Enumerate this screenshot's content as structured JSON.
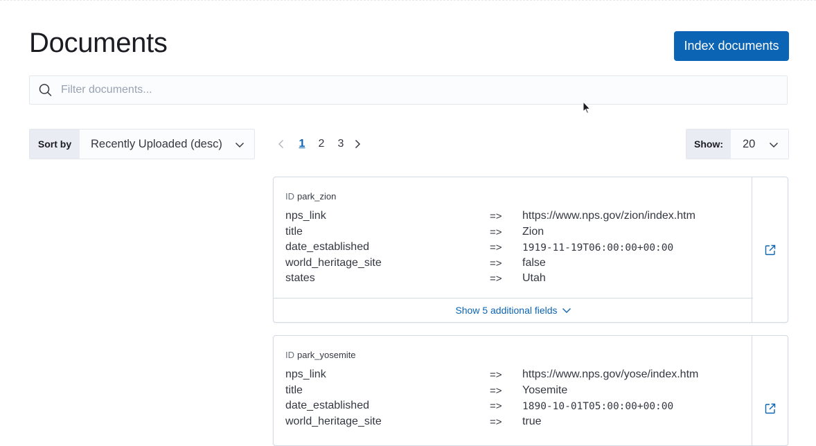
{
  "page": {
    "title": "Documents"
  },
  "header": {
    "index_button_label": "Index documents"
  },
  "search": {
    "placeholder": "Filter documents..."
  },
  "sort": {
    "label": "Sort by",
    "selected": "Recently Uploaded (desc)"
  },
  "pagination": {
    "pages": [
      "1",
      "2",
      "3"
    ],
    "current": "1"
  },
  "page_size": {
    "label": "Show:",
    "selected": "20"
  },
  "documents": [
    {
      "id_prefix": "ID",
      "id": "park_zion",
      "fields": [
        {
          "name": "nps_link",
          "sep": "=>",
          "value": "https://www.nps.gov/zion/index.htm",
          "mono": false
        },
        {
          "name": "title",
          "sep": "=>",
          "value": "Zion",
          "mono": false
        },
        {
          "name": "date_established",
          "sep": "=>",
          "value": "1919-11-19T06:00:00+00:00",
          "mono": true
        },
        {
          "name": "world_heritage_site",
          "sep": "=>",
          "value": "false",
          "mono": false
        },
        {
          "name": "states",
          "sep": "=>",
          "value": "Utah",
          "mono": false
        }
      ],
      "footer_label": "Show 5 additional fields"
    },
    {
      "id_prefix": "ID",
      "id": "park_yosemite",
      "fields": [
        {
          "name": "nps_link",
          "sep": "=>",
          "value": "https://www.nps.gov/yose/index.htm",
          "mono": false
        },
        {
          "name": "title",
          "sep": "=>",
          "value": "Yosemite",
          "mono": false
        },
        {
          "name": "date_established",
          "sep": "=>",
          "value": "1890-10-01T05:00:00+00:00",
          "mono": true
        },
        {
          "name": "world_heritage_site",
          "sep": "=>",
          "value": "true",
          "mono": false
        }
      ]
    }
  ],
  "colors": {
    "accent": "#0b64b4",
    "border": "#d3dae6",
    "label_bg": "#e9edf3"
  },
  "icons": {
    "search": "search-icon",
    "chevron": "chevron-down-icon",
    "prev": "chevron-left-icon",
    "next": "chevron-right-icon",
    "external": "external-link-icon"
  }
}
